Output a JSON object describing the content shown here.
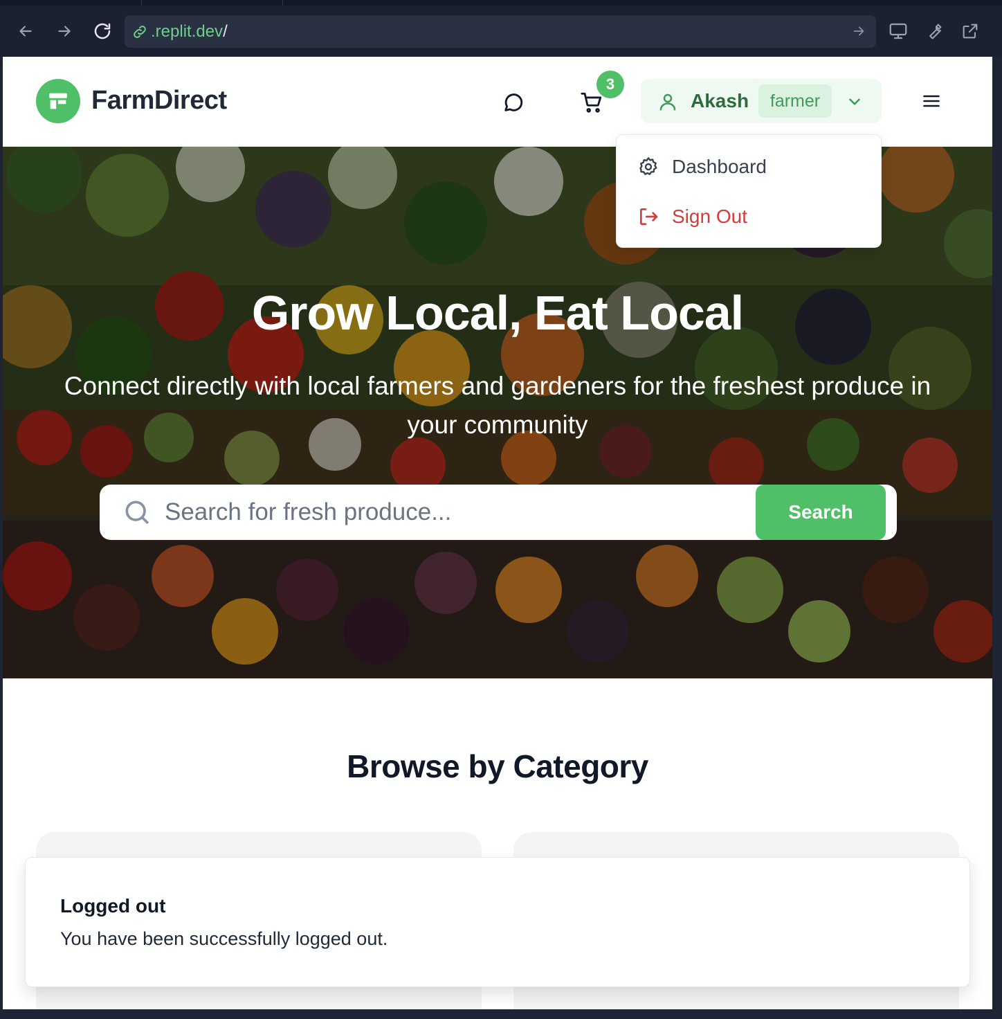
{
  "browser": {
    "url_host": ".replit.dev",
    "url_path": "/"
  },
  "header": {
    "brand": "FarmDirect",
    "cart_count": "3",
    "user": {
      "name": "Akash",
      "role": "farmer"
    }
  },
  "user_dropdown": {
    "items": [
      {
        "label": "Dashboard",
        "icon": "gear-icon"
      },
      {
        "label": "Sign Out",
        "icon": "sign-out-icon"
      }
    ]
  },
  "hero": {
    "title": "Grow Local, Eat Local",
    "subtitle": "Connect directly with local farmers and gardeners for the freshest produce in your community",
    "search": {
      "placeholder": "Search for fresh produce...",
      "button_label": "Search"
    }
  },
  "categories": {
    "title": "Browse by Category"
  },
  "toast": {
    "title": "Logged out",
    "description": "You have been successfully logged out."
  },
  "colors": {
    "brand_green": "#4fbf68",
    "danger_red": "#d63b3b",
    "chrome_bg": "#1b2130"
  }
}
